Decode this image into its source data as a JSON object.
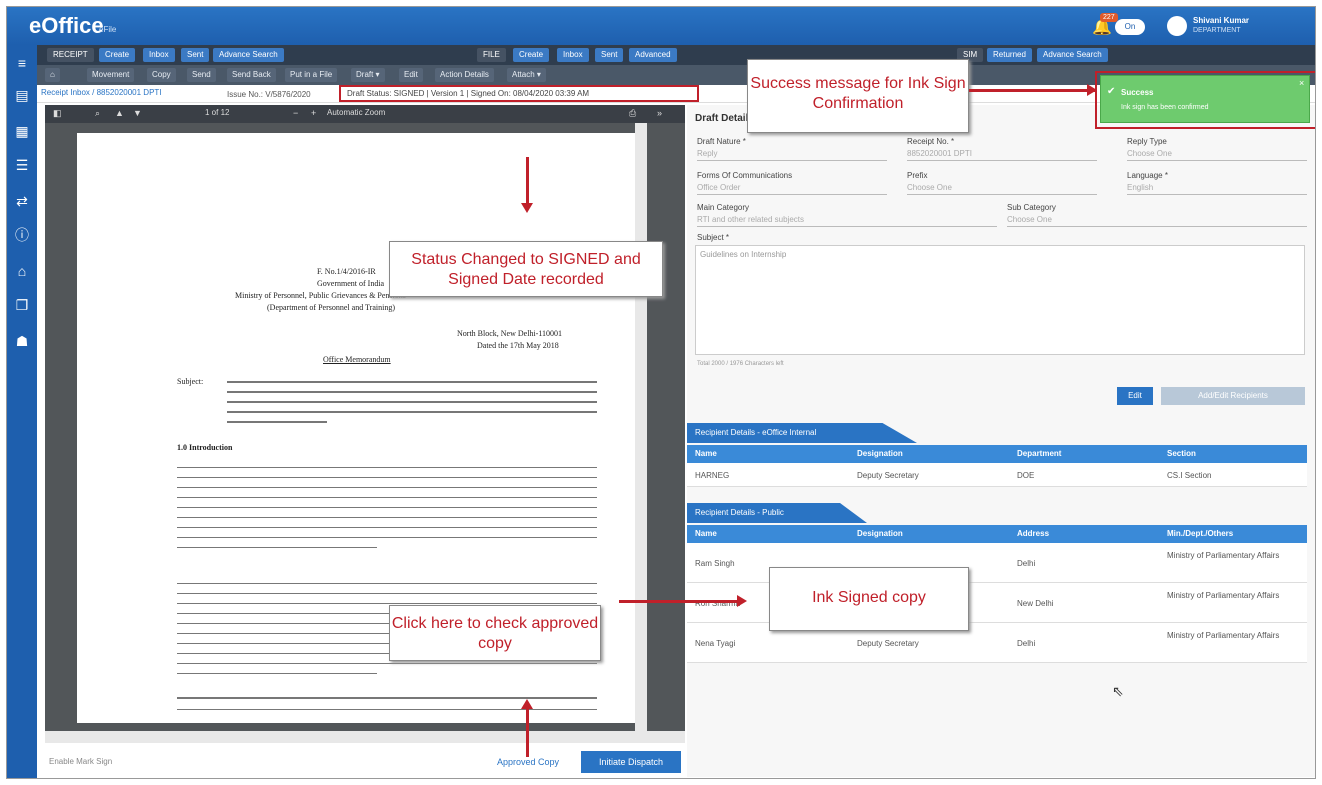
{
  "app": {
    "logo": "eOffice",
    "logo_sub": "eFile",
    "notif_count": "227",
    "toggle": "On",
    "user_name": "Shivani Kumar",
    "user_role": "DEPARTMENT"
  },
  "tabs": {
    "receipt": "RECEIPT",
    "create": "Create",
    "inbox": "Inbox",
    "sent": "Sent",
    "advanced_search": "Advance Search",
    "file": "FILE",
    "file_create": "Create",
    "file_inbox": "Inbox",
    "file_sent": "Sent",
    "file_advanced": "Advanced",
    "sim": "SIM",
    "returned": "Returned",
    "adv_search2": "Advance Search"
  },
  "toolbar": {
    "movement": "Movement",
    "copy": "Copy",
    "send": "Send",
    "sendback": "Send Back",
    "putinfile": "Put in a File",
    "draft": "Draft ▾",
    "edit": "Edit",
    "action_details": "Action Details",
    "attach": "Attach ▾"
  },
  "breadcrumb": "Receipt Inbox / 8852020001 DPTI",
  "issue_no": "Issue No.: V/5876/2020",
  "status": "Draft Status: SIGNED | Version 1 | Signed On: 08/04/2020 03:39 AM",
  "pdf": {
    "page_of": "1 of 12",
    "zoom": "Automatic Zoom"
  },
  "doc": {
    "l1": "F. No.1/4/2016-IR",
    "l2": "Government of India",
    "l3": "Ministry of Personnel, Public Grievances & Pensions",
    "l4": "(Department of Personnel and Training)",
    "l5": "North Block, New Delhi-110001",
    "l6": "Dated the 17th May 2018",
    "l7": "Office Memorandum",
    "subject_label": "Subject:",
    "h1": "1.0 Introduction"
  },
  "bottom": {
    "enable_sign": "Enable Mark Sign",
    "approved_copy": "Approved Copy",
    "initiate": "Initiate Dispatch"
  },
  "draft": {
    "header": "Draft Details",
    "nature_label": "Draft Nature *",
    "nature_val": "Reply",
    "receipt_label": "Receipt No. *",
    "receipt_val": "8852020001 DPTI",
    "reply_type_label": "Reply Type",
    "reply_type_val": "Choose One",
    "forms_label": "Forms Of Communications",
    "forms_val": "Office Order",
    "prefix_label": "Prefix",
    "prefix_val": "Choose One",
    "language_label": "Language *",
    "language_val": "English",
    "main_cat_label": "Main Category",
    "main_cat_val": "RTI and other related subjects",
    "sub_cat_label": "Sub Category",
    "sub_cat_val": "Choose One",
    "subject_label": "Subject *",
    "subject_val": "Guidelines on Internship",
    "char_count": "Total 2000 / 1976 Characters left",
    "edit_btn": "Edit",
    "add_edit_btn": "Add/Edit Recipients"
  },
  "recipients_internal": {
    "header": "Recipient Details - eOffice Internal",
    "cols": [
      "Name",
      "Designation",
      "Department",
      "Section"
    ],
    "rows": [
      [
        "HARNEG",
        "Deputy Secretary",
        "DOE",
        "CS.I Section"
      ]
    ]
  },
  "recipients_public": {
    "header": "Recipient Details - Public",
    "cols": [
      "Name",
      "Designation",
      "Address",
      "Min./Dept./Others"
    ],
    "rows": [
      [
        "Ram Singh",
        "",
        "Delhi",
        "Ministry of Parliamentary Affairs"
      ],
      [
        "Ron Sharma",
        "",
        "New Delhi",
        "Ministry of Parliamentary Affairs"
      ],
      [
        "Nena Tyagi",
        "Deputy Secretary",
        "Delhi",
        "Ministry of Parliamentary Affairs"
      ]
    ]
  },
  "toast": {
    "title": "Success",
    "msg": "Ink sign has been confirmed"
  },
  "callouts": {
    "success": "Success message for Ink Sign Confirmation",
    "status": "Status Changed to SIGNED and Signed Date recorded",
    "ink": "Ink Signed copy",
    "click": "Click here to check approved copy"
  },
  "colors": {
    "topbar": "#1e5fae",
    "accent": "#2a74c4",
    "annotation": "#c0202a",
    "toast": "#6ecb6e"
  }
}
